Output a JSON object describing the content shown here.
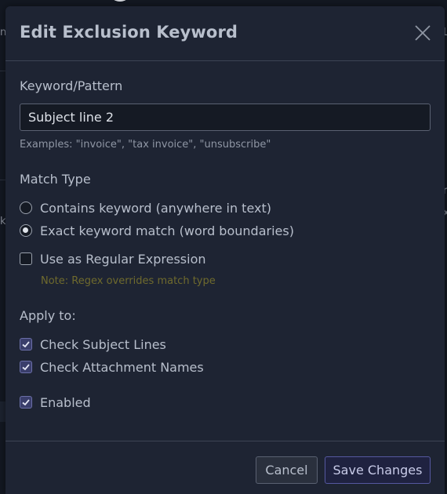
{
  "background": {
    "edge_glyphs": {
      "left_top": "n",
      "left_mid": "k",
      "right_top": "L",
      "right_mid1": "r",
      "right_mid2": "x"
    }
  },
  "dialog": {
    "title": "Edit Exclusion Keyword",
    "close_icon": "close-icon",
    "keyword": {
      "label": "Keyword/Pattern",
      "value": "Subject line 2",
      "hint": "Examples: \"invoice\", \"tax invoice\", \"unsubscribe\""
    },
    "match_type": {
      "label": "Match Type",
      "options": [
        {
          "label": "Contains keyword (anywhere in text)",
          "selected": false
        },
        {
          "label": "Exact keyword match (word boundaries)",
          "selected": true
        }
      ]
    },
    "regex": {
      "label": "Use as Regular Expression",
      "checked": false,
      "note": "Note: Regex overrides match type"
    },
    "apply_to": {
      "label": "Apply to:",
      "options": [
        {
          "label": "Check Subject Lines",
          "checked": true
        },
        {
          "label": "Check Attachment Names",
          "checked": true
        }
      ]
    },
    "enabled": {
      "label": "Enabled",
      "checked": true
    },
    "buttons": {
      "cancel": "Cancel",
      "save": "Save Changes"
    }
  },
  "colors": {
    "backdrop": "#131822",
    "modal": "#1e2433",
    "accent": "#5558a0",
    "warning_note": "#6f6a2d"
  }
}
